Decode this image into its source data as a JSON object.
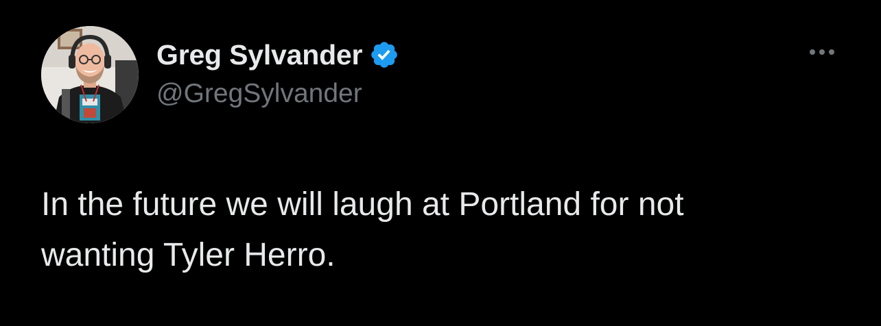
{
  "tweet": {
    "author": {
      "display_name": "Greg Sylvander",
      "handle": "@GregSylvander",
      "verified": true,
      "verified_badge_color": "#1d9bf0"
    },
    "more_icon": "more-horizontal-icon",
    "text_line_1": "In the future we will laugh at Portland for not",
    "text_line_2": "wanting Tyler Herro."
  },
  "colors": {
    "background": "#000000",
    "primary_text": "#e7e9ea",
    "secondary_text": "#71767b"
  }
}
